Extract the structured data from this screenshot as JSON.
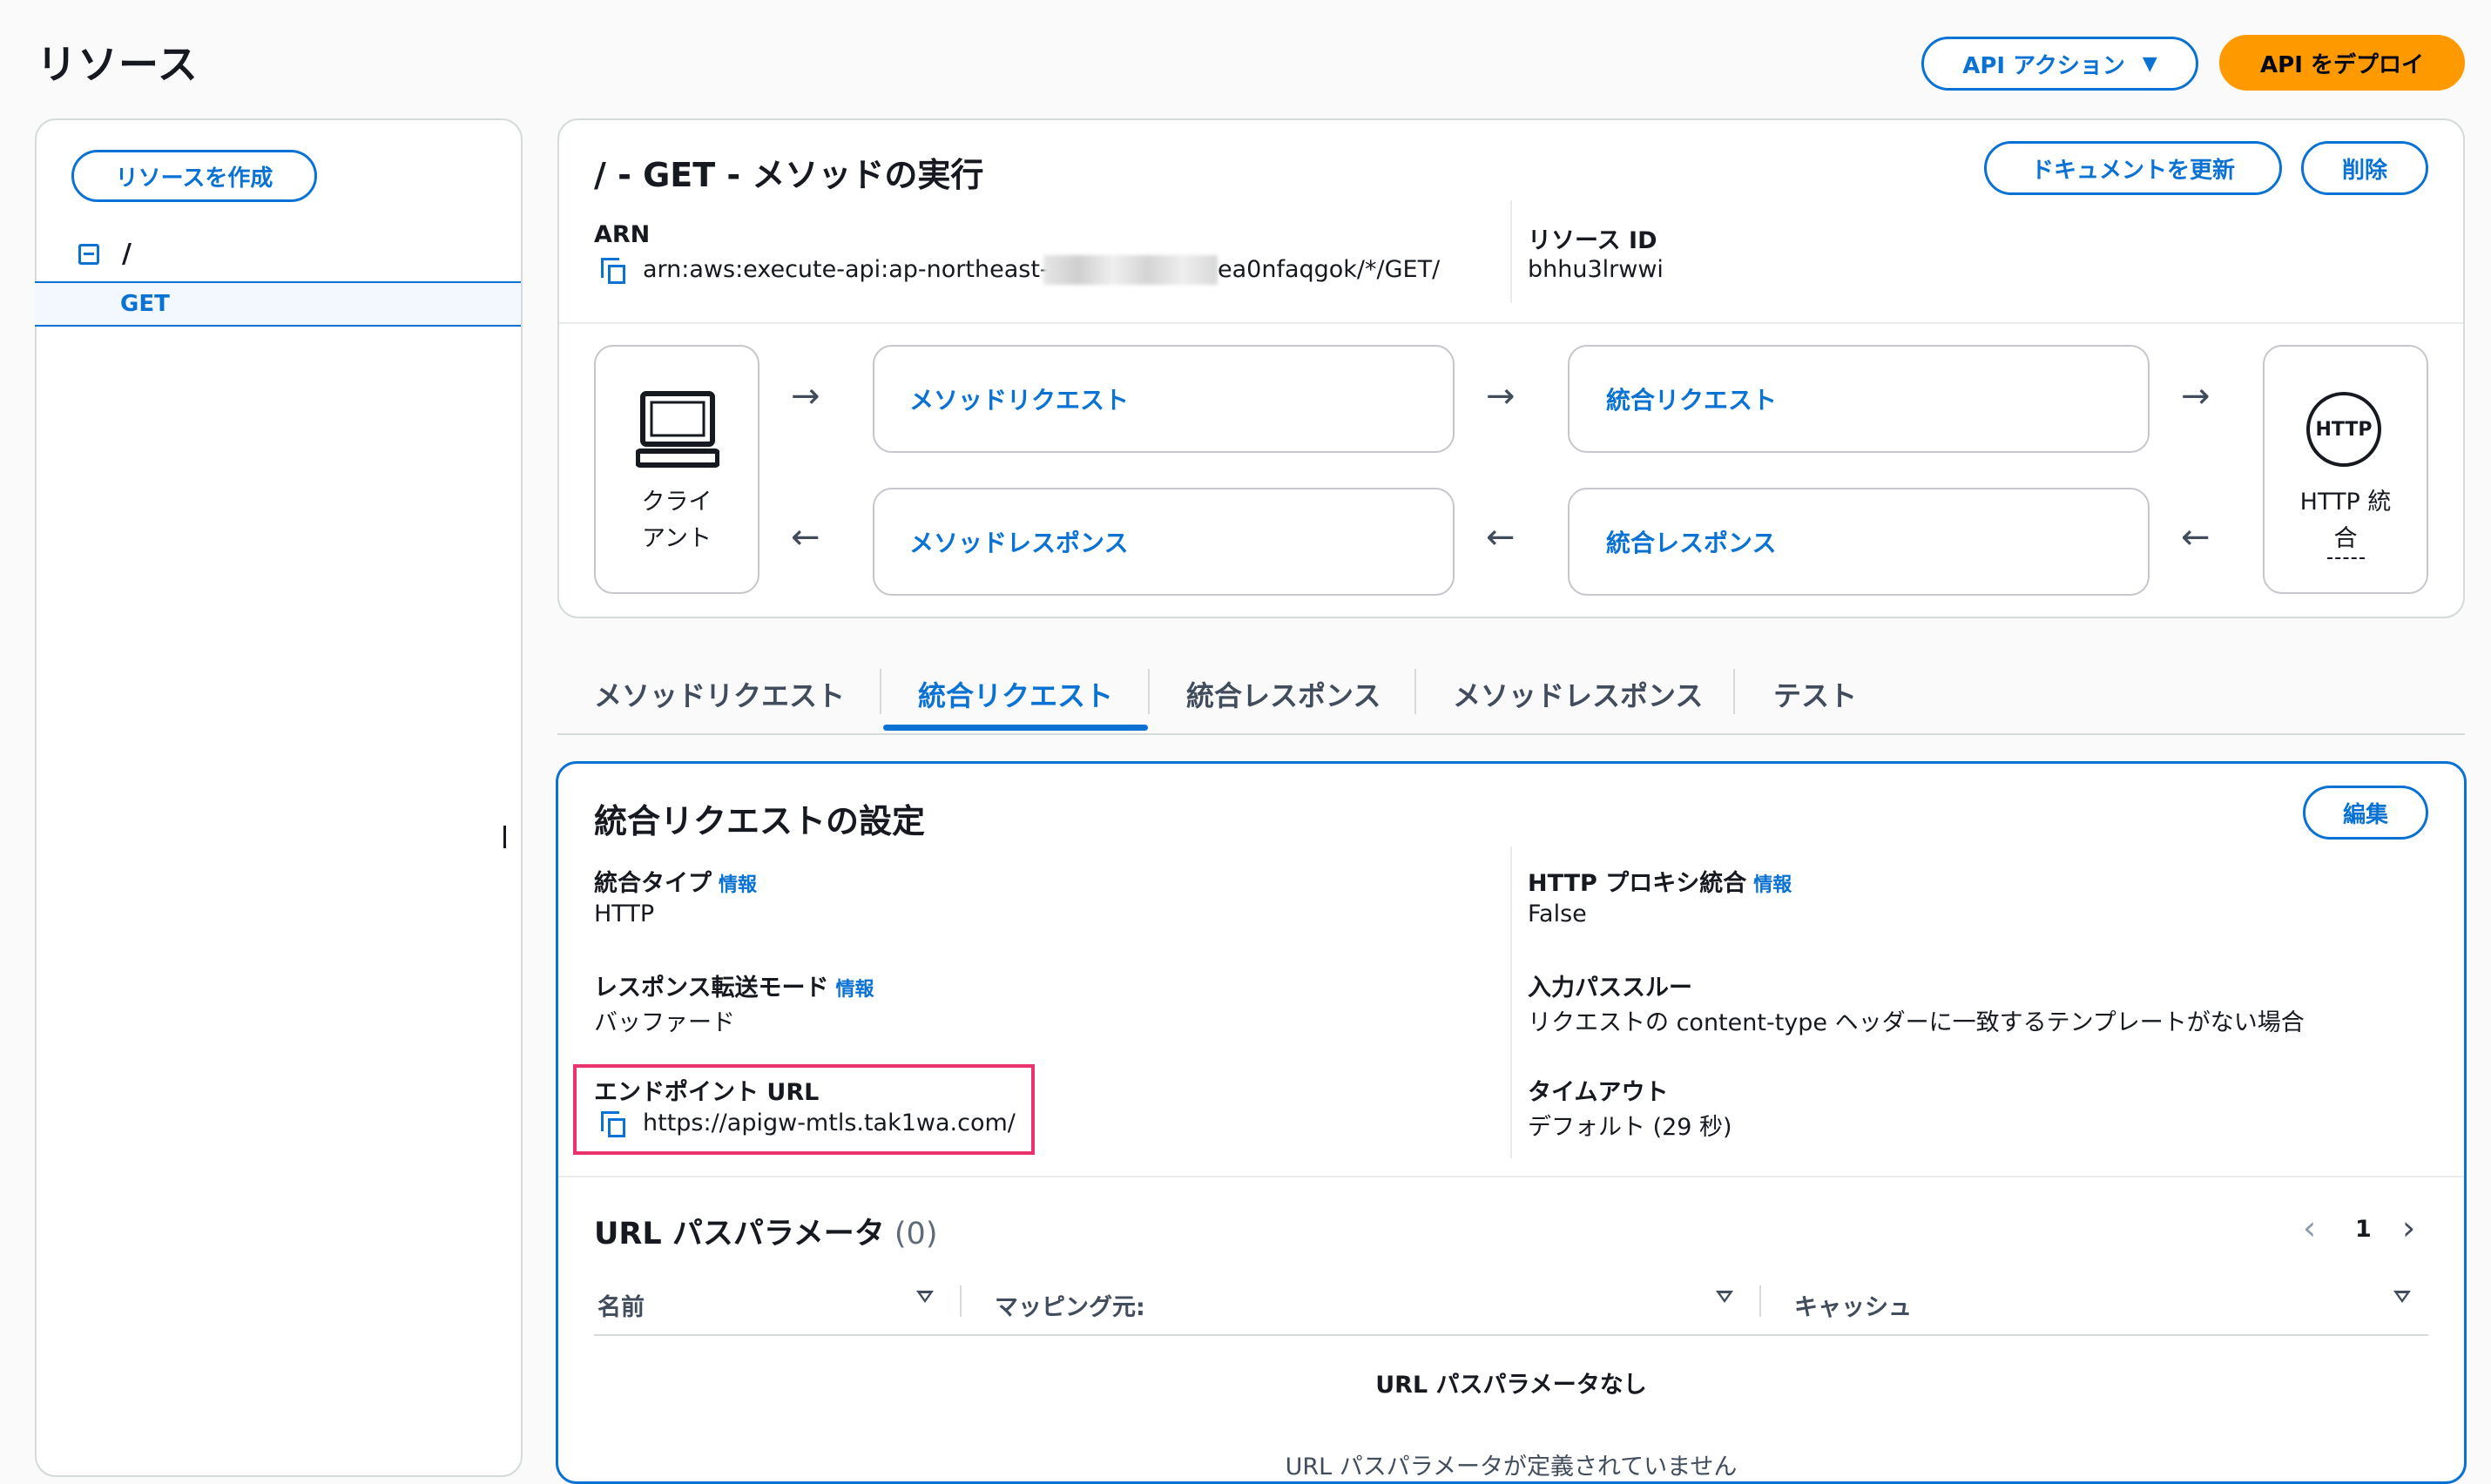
{
  "page": {
    "title": "リソース"
  },
  "header": {
    "api_actions_label": "API アクション",
    "deploy_label": "API をデプロイ"
  },
  "sidebar": {
    "create_resource_label": "リソースを作成",
    "root": "/",
    "selected_method": "GET"
  },
  "method": {
    "title": "/ - GET - メソッドの実行",
    "update_doc_label": "ドキュメントを更新",
    "delete_label": "削除",
    "arn_label": "ARN",
    "arn_prefix": "arn:aws:execute-api:ap-northeast-1:",
    "arn_suffix": "ea0nfaqgok/*/GET/",
    "resource_id_label": "リソース ID",
    "resource_id": "bhhu3lrwwi"
  },
  "flow": {
    "client_line1": "クライ",
    "client_line2": "アント",
    "method_request": "メソッドリクエスト",
    "integration_request": "統合リクエスト",
    "method_response": "メソッドレスポンス",
    "integration_response": "統合レスポンス",
    "http_badge": "HTTP",
    "http_line1": "HTTP 統",
    "http_line2": "合"
  },
  "tabs": [
    {
      "label": "メソッドリクエスト"
    },
    {
      "label": "統合リクエスト"
    },
    {
      "label": "統合レスポンス"
    },
    {
      "label": "メソッドレスポンス"
    },
    {
      "label": "テスト"
    }
  ],
  "integration": {
    "title": "統合リクエストの設定",
    "edit_label": "編集",
    "info_label": "情報",
    "type_label": "統合タイプ",
    "type_value": "HTTP",
    "proxy_label": "HTTP プロキシ統合",
    "proxy_value": "False",
    "transfer_label": "レスポンス転送モード",
    "transfer_value": "バッファード",
    "passthrough_label": "入力パススルー",
    "passthrough_value": "リクエストの content-type ヘッダーに一致するテンプレートがない場合",
    "endpoint_label": "エンドポイント URL",
    "endpoint_value": "https://apigw-mtls.tak1wa.com/",
    "timeout_label": "タイムアウト",
    "timeout_value": "デフォルト (29 秒)"
  },
  "path_params": {
    "title": "URL パスパラメータ",
    "count": "(0)",
    "page": "1",
    "columns": [
      "名前",
      "マッピング元:",
      "キャッシュ"
    ],
    "empty_title": "URL パスパラメータなし",
    "empty_detail": "URL パスパラメータが定義されていません"
  },
  "colors": {
    "accent": "#0972d3",
    "primary": "#ff9900",
    "highlight": "#e8336d"
  }
}
